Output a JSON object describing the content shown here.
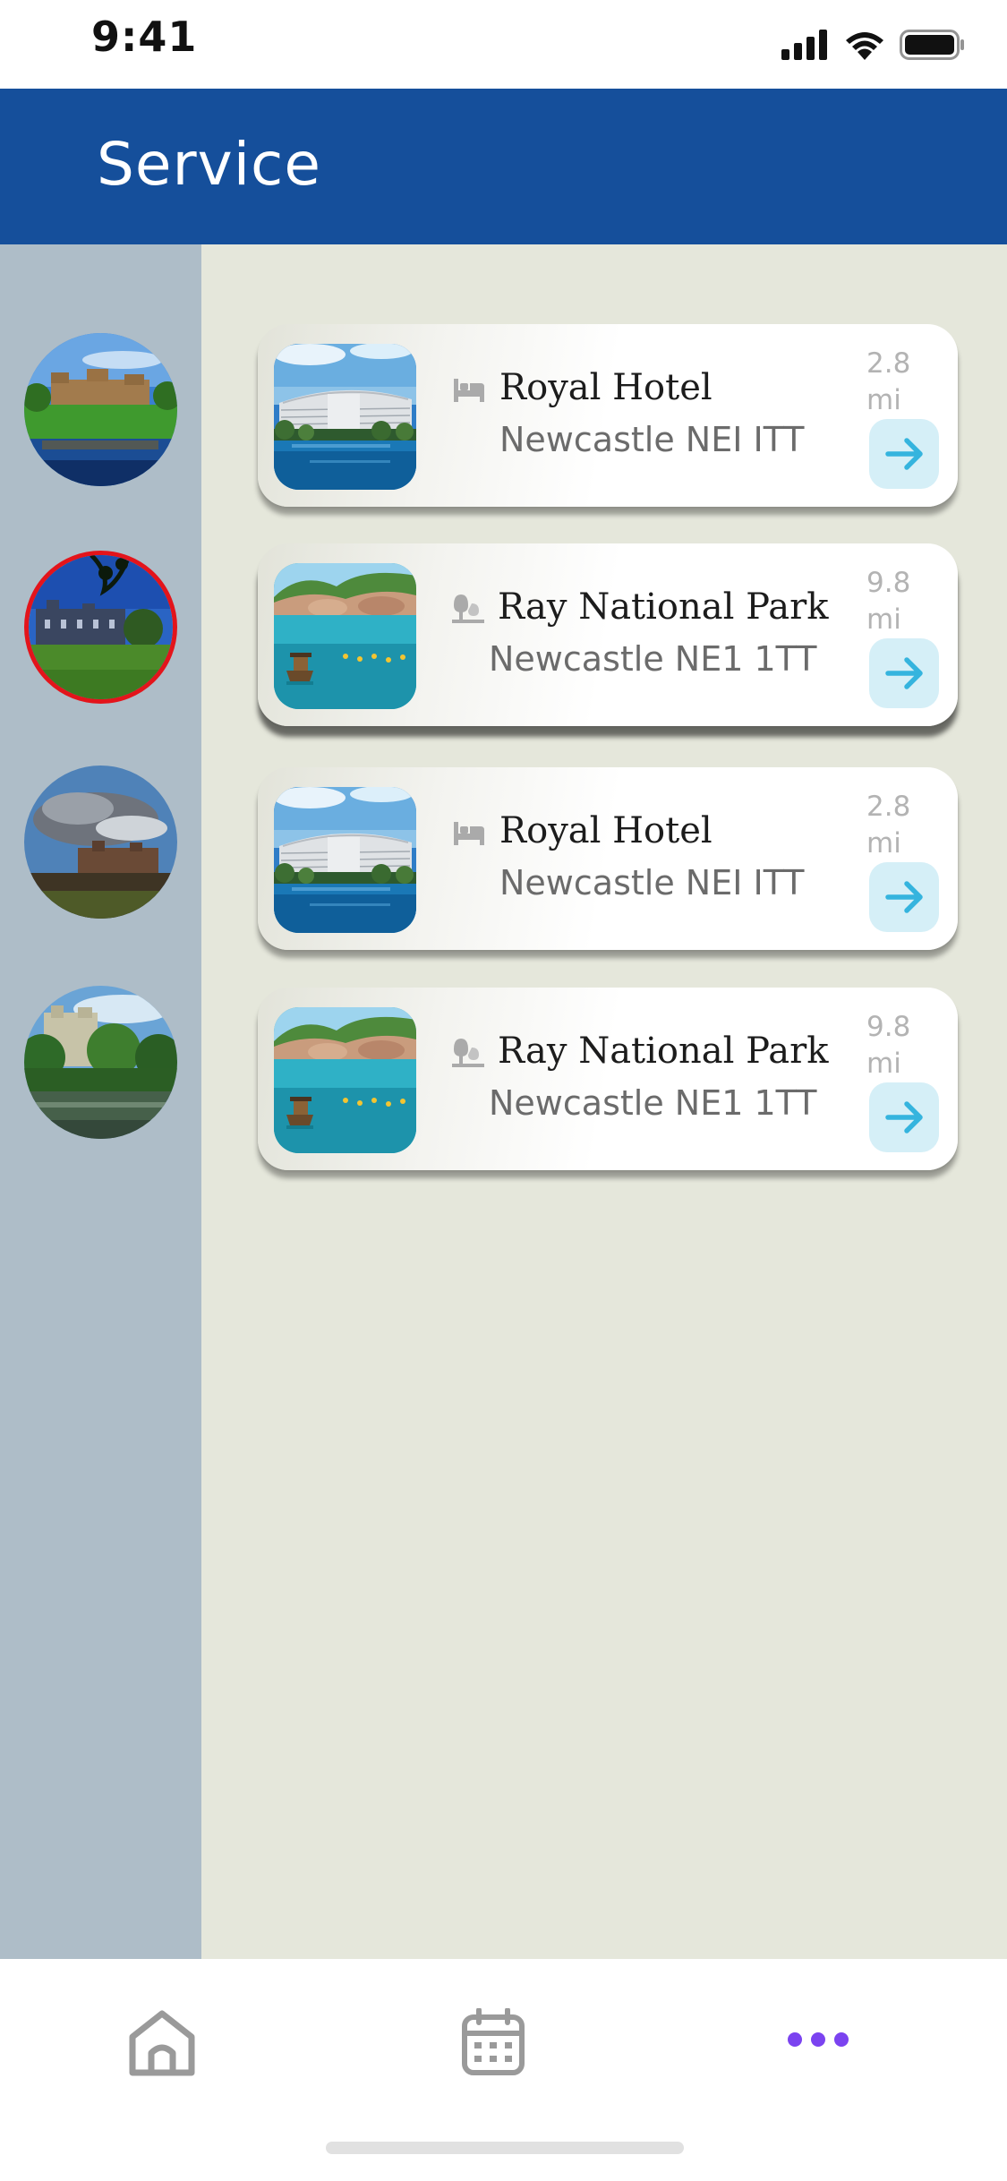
{
  "status": {
    "time": "9:41",
    "icons": [
      "signal-icon",
      "wifi-icon",
      "battery-icon"
    ]
  },
  "header": {
    "title": "Service",
    "color": "#154f9b"
  },
  "sidebar": {
    "color": "#aebdc8",
    "selected_index": 1,
    "selected_color": "#e3141b",
    "items": [
      {
        "scene": "castle-on-lake"
      },
      {
        "scene": "manor-with-lawn"
      },
      {
        "scene": "castle-under-clouds"
      },
      {
        "scene": "castle-over-river"
      }
    ]
  },
  "cards": [
    {
      "category_icon": "bed-icon",
      "title": "Royal Hotel",
      "address": "Newcastle NEI ITT",
      "distance_value": "2.8",
      "distance_unit": "mi",
      "image": "hotel-pool"
    },
    {
      "category_icon": "tree-icon",
      "title": "Ray National Park",
      "address": "Newcastle NE1 1TT",
      "distance_value": "9.8",
      "distance_unit": "mi",
      "image": "lake-boat"
    },
    {
      "category_icon": "bed-icon",
      "title": "Royal Hotel",
      "address": "Newcastle NEI ITT",
      "distance_value": "2.8",
      "distance_unit": "mi",
      "image": "hotel-pool"
    },
    {
      "category_icon": "tree-icon",
      "title": "Ray National Park",
      "address": "Newcastle NE1 1TT",
      "distance_value": "9.8",
      "distance_unit": "mi",
      "image": "lake-boat"
    }
  ],
  "tabbar": {
    "tabs": [
      "home-icon",
      "calendar-icon",
      "more-icon"
    ],
    "active_index": 2,
    "active_color": "#7b43f0",
    "inactive_color": "#9a9a9a"
  }
}
